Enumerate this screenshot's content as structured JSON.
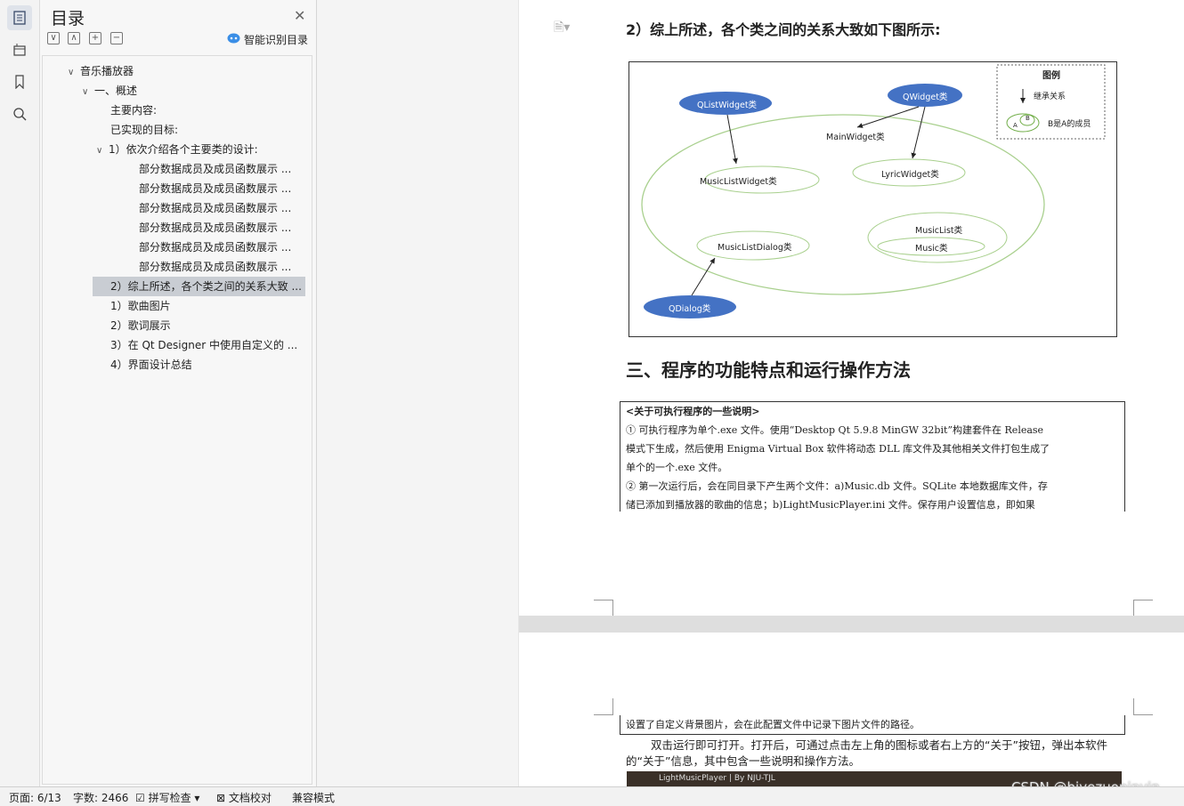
{
  "toc": {
    "title": "目录",
    "smart_label": "智能识别目录",
    "items": [
      {
        "label": "音乐播放器",
        "level": 0,
        "caret": "∨"
      },
      {
        "label": "一、概述",
        "level": 1,
        "caret": "∨"
      },
      {
        "label": "主要内容:",
        "level": 2,
        "caret": ""
      },
      {
        "label": "已实现的目标:",
        "level": 2,
        "caret": ""
      },
      {
        "label": "1）依次介绍各个主要类的设计:",
        "level": 1,
        "caret": "∨"
      },
      {
        "label": "部分数据成员及成员函数展示 ...",
        "level": 3,
        "caret": ""
      },
      {
        "label": "部分数据成员及成员函数展示 ...",
        "level": 3,
        "caret": ""
      },
      {
        "label": "部分数据成员及成员函数展示 ...",
        "level": 3,
        "caret": ""
      },
      {
        "label": "部分数据成员及成员函数展示 ...",
        "level": 3,
        "caret": ""
      },
      {
        "label": "部分数据成员及成员函数展示 ...",
        "level": 3,
        "caret": ""
      },
      {
        "label": "部分数据成员及成员函数展示 ...",
        "level": 3,
        "caret": ""
      },
      {
        "label": "2）综上所述，各个类之间的关系大致 ...",
        "level": 2,
        "caret": "",
        "selected": true
      },
      {
        "label": "1）歌曲图片",
        "level": 2,
        "caret": ""
      },
      {
        "label": "2）歌词展示",
        "level": 2,
        "caret": ""
      },
      {
        "label": "3）在 Qt Designer 中使用自定义的 ...",
        "level": 2,
        "caret": ""
      },
      {
        "label": "4）界面设计总结",
        "level": 2,
        "caret": ""
      }
    ]
  },
  "document": {
    "heading": "2）综上所述，各个类之间的关系大致如下图所示:",
    "section3": "三、程序的功能特点和运行操作方法",
    "note_lines": [
      "<关于可执行程序的一些说明>",
      "① 可执行程序为单个.exe 文件。使用“Desktop Qt 5.9.8 MinGW 32bit”构建套件在 Release",
      "模式下生成，然后使用 Enigma Virtual Box 软件将动态 DLL 库文件及其他相关文件打包生成了",
      "单个的一个.exe 文件。",
      "② 第一次运行后，会在同目录下产生两个文件：a)Music.db 文件。SQLite 本地数据库文件，存",
      "储已添加到播放器的歌曲的信息；b)LightMusicPlayer.ini 文件。保存用户设置信息，即如果"
    ],
    "note_line_page2": "设置了自定义背景图片，会在此配置文件中记录下图片文件的路径。",
    "paragraph": "双击运行即可打开。打开后，可通过点击左上角的图标或者右上方的“关于”按钮，弹出本软件的“关于”信息，其中包含一些说明和操作方法。",
    "screenshot_caption": "LightMusicPlayer | By NJU-TJL"
  },
  "diagram": {
    "legend_title": "图例",
    "legend_inherit": "继承关系",
    "legend_member": "B是A的成员",
    "legend_a": "A",
    "legend_b": "B",
    "nodes": {
      "qlistwidget": "QListWidget类",
      "qwidget": "QWidget类",
      "mainwidget": "MainWidget类",
      "musiclistwidget": "MusicListWidget类",
      "lyricwidget": "LyricWidget类",
      "musiclist": "MusicList类",
      "music": "Music类",
      "musiclistdialog": "MusicListDialog类",
      "qdialog": "QDialog类"
    },
    "colors": {
      "base_class": "#4472c4",
      "member_outline": "#70ad47"
    }
  },
  "status": {
    "page": "页面: 6/13",
    "words": "字数: 2466",
    "spell": "拼写检查",
    "proof": "文档校对",
    "compat": "兼容模式"
  },
  "watermark": "CSDN @biyezuopinvip"
}
